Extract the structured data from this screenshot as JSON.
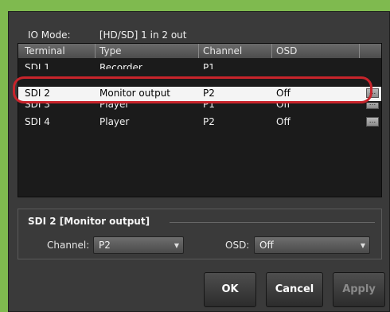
{
  "io_mode": {
    "label": "IO Mode:",
    "value": "[HD/SD] 1 in 2 out"
  },
  "list": {
    "headers": {
      "terminal": "Terminal",
      "type": "Type",
      "channel": "Channel",
      "osd": "OSD"
    },
    "rows": [
      {
        "terminal": "SDI 1",
        "type": "Recorder",
        "channel": "P1",
        "osd": ""
      },
      {
        "terminal": "SDI 2",
        "type": "Monitor output",
        "channel": "P2",
        "osd": "Off"
      },
      {
        "terminal": "SDI 3",
        "type": "Player",
        "channel": "P1",
        "osd": "Off"
      },
      {
        "terminal": "SDI 4",
        "type": "Player",
        "channel": "P2",
        "osd": "Off"
      }
    ],
    "row_button": "..."
  },
  "detail": {
    "title": "SDI 2 [Monitor output]",
    "channel_label": "Channel:",
    "channel_value": "P2",
    "osd_label": "OSD:",
    "osd_value": "Off"
  },
  "buttons": {
    "ok": "OK",
    "cancel": "Cancel",
    "apply": "Apply"
  },
  "colors": {
    "selection_ring": "#c8242b",
    "background": "#7fba4f"
  }
}
